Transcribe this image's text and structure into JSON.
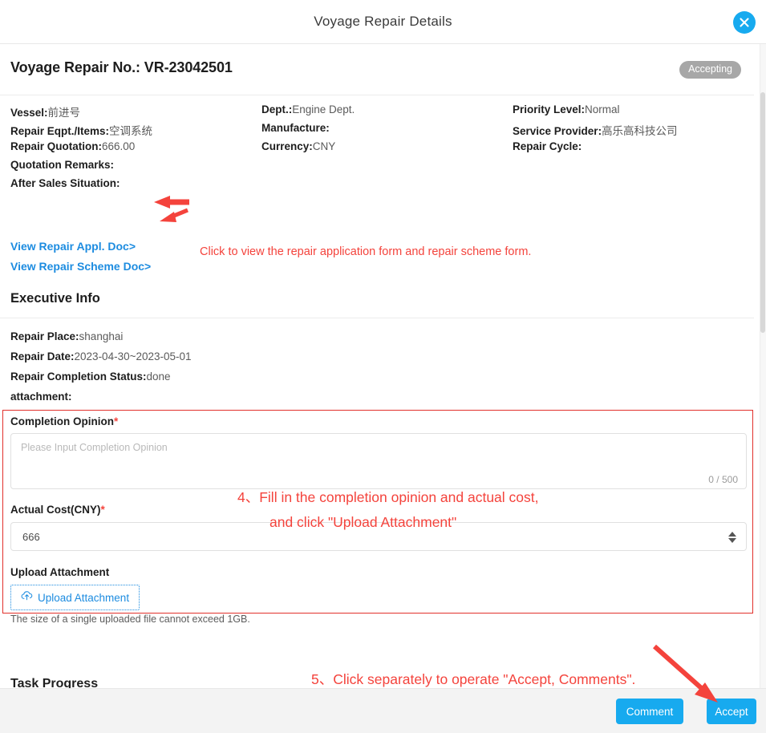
{
  "header": {
    "title": "Voyage Repair Details",
    "close_icon": "close-icon"
  },
  "repair": {
    "no_label": "Voyage Repair No.: VR-23042501",
    "status_badge": "Accepting"
  },
  "basic_info": {
    "rows": [
      [
        {
          "label": "Vessel:",
          "value": "前进号"
        },
        {
          "label": "Dept.:",
          "value": "Engine Dept."
        },
        {
          "label": "Priority Level:",
          "value": "Normal"
        }
      ],
      [
        {
          "label": "Repair Eqpt./Items:",
          "value": "空调系统"
        },
        {
          "label": "Manufacture:",
          "value": ""
        },
        {
          "label": "Service Provider:",
          "value": "高乐高科技公司"
        }
      ],
      [
        {
          "label": "Repair Quotation:",
          "value": "666.00"
        },
        {
          "label": "Currency:",
          "value": "CNY"
        },
        {
          "label": "Repair Cycle:",
          "value": ""
        }
      ],
      [
        {
          "label": "Quotation Remarks:",
          "value": ""
        },
        {
          "label": "",
          "value": ""
        },
        {
          "label": "",
          "value": ""
        }
      ],
      [
        {
          "label": "After Sales Situation:",
          "value": ""
        },
        {
          "label": "",
          "value": ""
        },
        {
          "label": "",
          "value": ""
        }
      ]
    ]
  },
  "links": {
    "view_appl_doc": "View Repair Appl. Doc>",
    "view_scheme_doc": "View Repair Scheme Doc>"
  },
  "annotations": {
    "hint_links": "Click to view the repair application form and repair scheme form.",
    "hint_form_line1": "4、Fill in the completion opinion and actual cost,",
    "hint_form_line2": "and click \"Upload Attachment\"",
    "hint_buttons": "5、Click separately to operate \"Accept, Comments\".",
    "color": "#f4433c"
  },
  "executive": {
    "section_title": "Executive Info",
    "rows": [
      [
        {
          "label": "Repair Place:",
          "value": "shanghai"
        }
      ],
      [
        {
          "label": "Repair Date:",
          "value": "2023-04-30~2023-05-01"
        }
      ],
      [
        {
          "label": "Repair Completion Status:",
          "value": "done"
        }
      ],
      [
        {
          "label": "attachment:",
          "value": ""
        }
      ]
    ]
  },
  "form": {
    "completion_opinion": {
      "label": "Completion Opinion",
      "required_mark": "*",
      "placeholder": "Please Input Completion Opinion",
      "value": "",
      "counter": "0 / 500"
    },
    "actual_cost": {
      "label": "Actual Cost(CNY)",
      "required_mark": "*",
      "value": "666"
    },
    "upload": {
      "label": "Upload Attachment",
      "button_label": "Upload Attachment",
      "icon": "cloud-upload-icon",
      "note": "The size of a single uploaded file cannot exceed 1GB."
    }
  },
  "task_progress": {
    "title": "Task Progress"
  },
  "footer": {
    "comment_label": "Comment",
    "accept_label": "Accept",
    "button_color": "#17aaef"
  }
}
